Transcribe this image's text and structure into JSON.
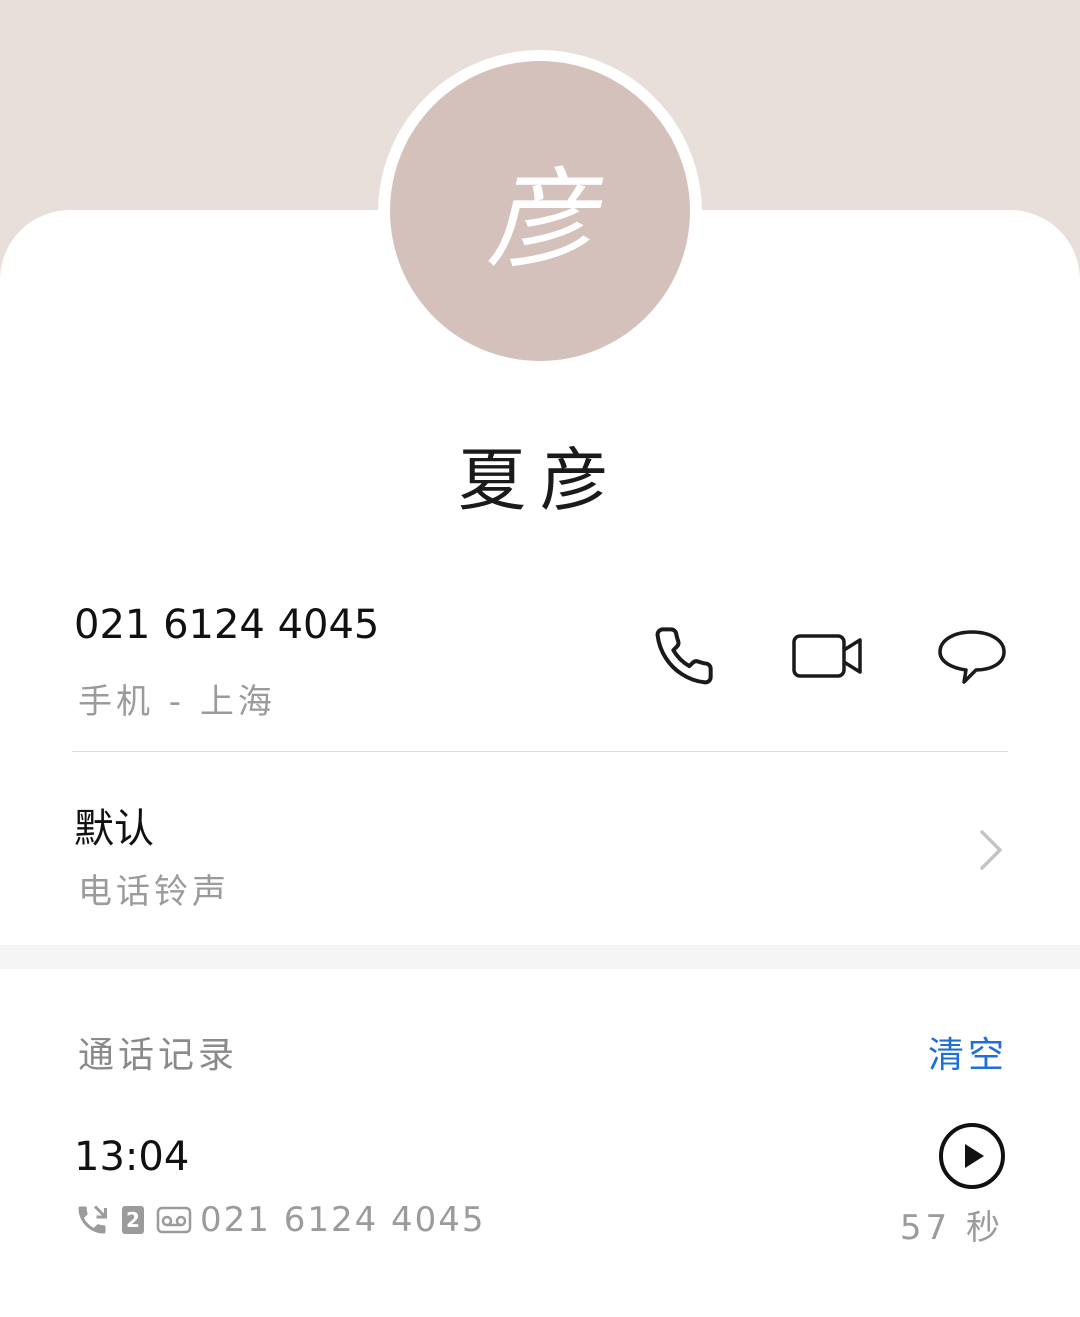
{
  "contact": {
    "avatar_char": "彦",
    "name": "夏彦"
  },
  "phone": {
    "number": "021 6124 4045",
    "label": "手机 - 上海",
    "actions": [
      "phone-icon",
      "video-call-icon",
      "message-icon"
    ]
  },
  "ringtone": {
    "value": "默认",
    "label": "电话铃声"
  },
  "call_log": {
    "title": "通话记录",
    "clear_label": "清空",
    "entries": [
      {
        "time": "13:04",
        "sim": "2",
        "number": "021 6124 4045",
        "duration": "57 秒",
        "icons": [
          "outgoing-call-icon",
          "sim-2-icon",
          "voicemail-icon"
        ]
      }
    ]
  },
  "colors": {
    "header_bg": "#e8dfda",
    "avatar_bg": "#d5c1bb",
    "accent": "#1e6fd9"
  }
}
